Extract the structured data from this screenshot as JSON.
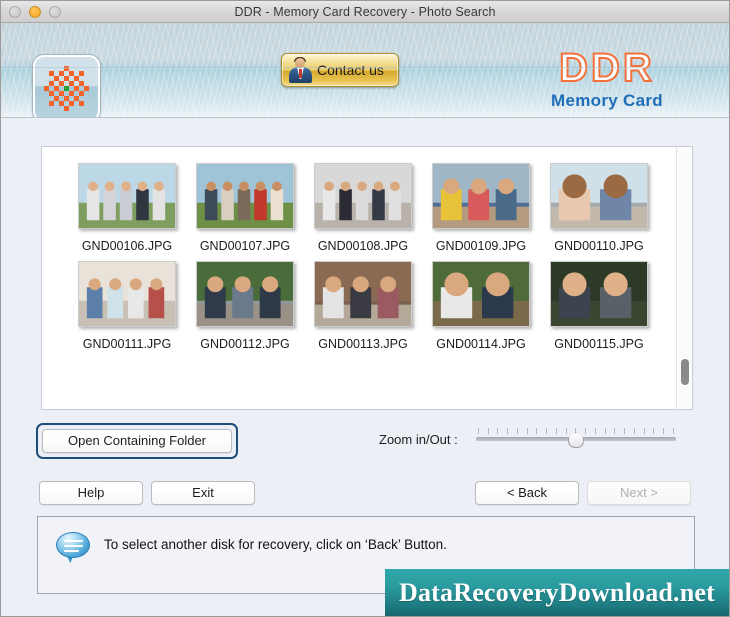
{
  "window": {
    "title": "DDR - Memory Card Recovery - Photo Search",
    "traffic_lights": {
      "close": "close-button",
      "minimize": "minimize-button",
      "zoom": "zoom-button"
    }
  },
  "header": {
    "app_icon_name": "ddr-app-icon",
    "contact_button": {
      "label": "Contact us",
      "icon": "person-icon"
    },
    "brand": {
      "title": "DDR",
      "subtitle": "Memory Card",
      "title_color": "#f4703a",
      "subtitle_color": "#1f6fb8"
    }
  },
  "thumbnails": [
    {
      "name": "GND00106.JPG",
      "scene": "group-of-teens-outdoors"
    },
    {
      "name": "GND00107.JPG",
      "scene": "friends-sitting-on-grass"
    },
    {
      "name": "GND00108.JPG",
      "scene": "group-photo-on-steps"
    },
    {
      "name": "GND00109.JPG",
      "scene": "family-on-blue-bridge"
    },
    {
      "name": "GND00110.JPG",
      "scene": "two-women-walking-path"
    },
    {
      "name": "GND00111.JPG",
      "scene": "friends-cheering-on-pier"
    },
    {
      "name": "GND00112.JPG",
      "scene": "family-with-stroller-bridge"
    },
    {
      "name": "GND00113.JPG",
      "scene": "family-crouching-on-bridge"
    },
    {
      "name": "GND00114.JPG",
      "scene": "hikers-with-backpacks-forest"
    },
    {
      "name": "GND00115.JPG",
      "scene": "couple-with-compass"
    }
  ],
  "controls": {
    "open_folder_label": "Open Containing Folder",
    "zoom_label": "Zoom in/Out :",
    "zoom_ticks": 21,
    "zoom_value_percent": 50
  },
  "buttons": {
    "help": "Help",
    "exit": "Exit",
    "back": "< Back",
    "next": "Next >",
    "next_enabled": false
  },
  "status": {
    "icon": "speech-bubble-icon",
    "message": "To select another disk for recovery, click on ‘Back’ Button."
  },
  "watermark": {
    "text": "DataRecoveryDownload.net",
    "color": "#2b9ca0"
  }
}
